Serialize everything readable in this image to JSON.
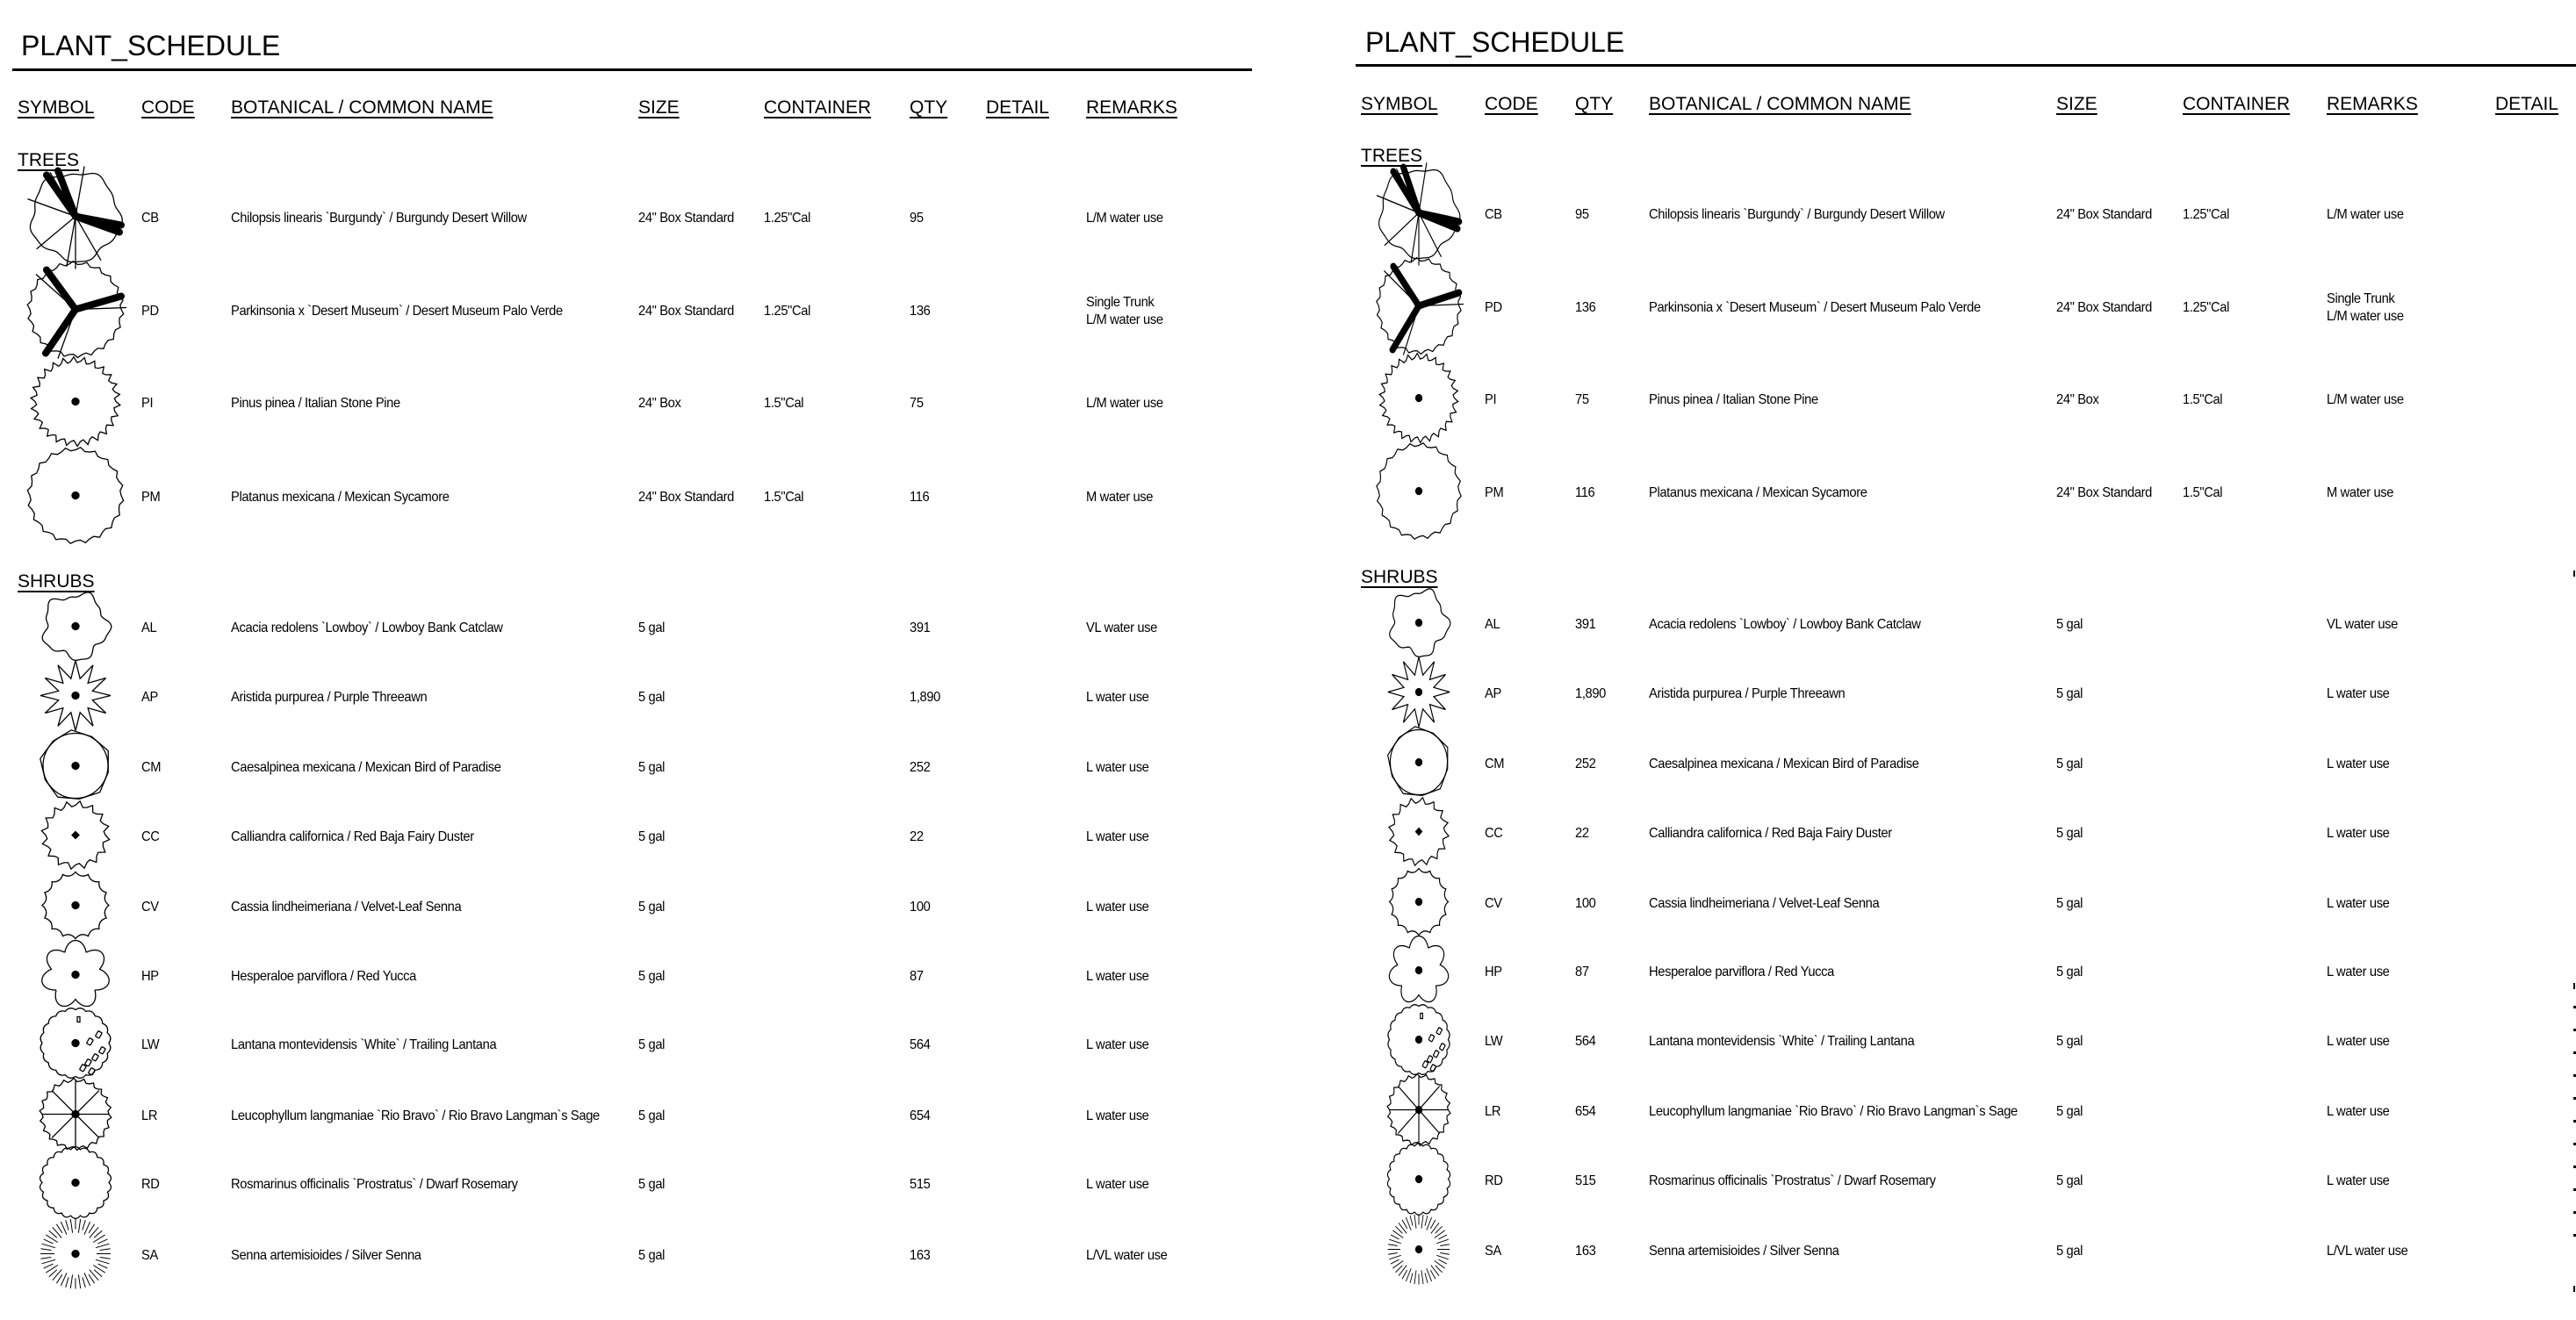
{
  "document": {
    "title": "PLANT_SCHEDULE",
    "sections": {
      "trees": "TREES",
      "shrubs": "SHRUBS"
    }
  },
  "panels": {
    "left": {
      "title": "PLANT_SCHEDULE",
      "headers": {
        "symbol": "SYMBOL",
        "code": "CODE",
        "name": "BOTANICAL / COMMON NAME",
        "size": "SIZE",
        "container": "CONTAINER",
        "qty": "QTY",
        "detail": "DETAIL",
        "remarks": "REMARKS"
      },
      "column_order": [
        "symbol",
        "code",
        "name",
        "size",
        "container",
        "qty",
        "detail",
        "remarks"
      ]
    },
    "right": {
      "title": "PLANT_SCHEDULE",
      "headers": {
        "symbol": "SYMBOL",
        "code": "CODE",
        "qty": "QTY",
        "name": "BOTANICAL / COMMON NAME",
        "size": "SIZE",
        "container": "CONTAINER",
        "remarks": "REMARKS",
        "detail": "DETAIL"
      },
      "column_order": [
        "symbol",
        "code",
        "qty",
        "name",
        "size",
        "container",
        "remarks",
        "detail"
      ]
    }
  },
  "trees": [
    {
      "symbol_icon": "chilopsis-tree-symbol",
      "code": "CB",
      "name": "Chilopsis linearis `Burgundy` / Burgundy Desert Willow",
      "size": "24\" Box Standard",
      "container": "1.25\"Cal",
      "qty": "95",
      "detail": "",
      "remarks": [
        "L/M water use"
      ]
    },
    {
      "symbol_icon": "parkinsonia-tree-symbol",
      "code": "PD",
      "name": "Parkinsonia x `Desert Museum` / Desert Museum Palo Verde",
      "size": "24\" Box Standard",
      "container": "1.25\"Cal",
      "qty": "136",
      "detail": "",
      "remarks": [
        "Single Trunk",
        "L/M water use"
      ]
    },
    {
      "symbol_icon": "pine-tree-symbol",
      "code": "PI",
      "name": "Pinus pinea / Italian Stone Pine",
      "size": "24\" Box",
      "container": "1.5\"Cal",
      "qty": "75",
      "detail": "",
      "remarks": [
        "L/M water use"
      ]
    },
    {
      "symbol_icon": "sycamore-tree-symbol",
      "code": "PM",
      "name": "Platanus mexicana / Mexican Sycamore",
      "size": "24\" Box Standard",
      "container": "1.5\"Cal",
      "qty": "116",
      "detail": "",
      "remarks": [
        "M water use"
      ]
    }
  ],
  "shrubs": [
    {
      "symbol_icon": "catclaw-shrub-symbol",
      "code": "AL",
      "name": "Acacia redolens `Lowboy` / Lowboy Bank Catclaw",
      "size": "5 gal",
      "container": "",
      "qty": "391",
      "detail": "",
      "remarks": [
        "VL water use"
      ]
    },
    {
      "symbol_icon": "threeawn-star-symbol",
      "code": "AP",
      "name": "Aristida purpurea / Purple Threeawn",
      "size": "5 gal",
      "container": "",
      "qty": "1,890",
      "detail": "",
      "remarks": [
        "L water use"
      ]
    },
    {
      "symbol_icon": "bird-of-paradise-shrub-symbol",
      "code": "CM",
      "name": "Caesalpinea mexicana / Mexican Bird of Paradise",
      "size": "5 gal",
      "container": "",
      "qty": "252",
      "detail": "",
      "remarks": [
        "L water use"
      ]
    },
    {
      "symbol_icon": "fairy-duster-shrub-symbol",
      "code": "CC",
      "name": "Calliandra californica / Red Baja Fairy Duster",
      "size": "5 gal",
      "container": "",
      "qty": "22",
      "detail": "",
      "remarks": [
        "L water use"
      ]
    },
    {
      "symbol_icon": "senna-scalloped-shrub-symbol",
      "code": "CV",
      "name": "Cassia lindheimeriana / Velvet-Leaf Senna",
      "size": "5 gal",
      "container": "",
      "qty": "100",
      "detail": "",
      "remarks": [
        "L water use"
      ]
    },
    {
      "symbol_icon": "yucca-flower-symbol",
      "code": "HP",
      "name": "Hesperaloe parviflora / Red Yucca",
      "size": "5 gal",
      "container": "",
      "qty": "87",
      "detail": "",
      "remarks": [
        "L water use"
      ]
    },
    {
      "symbol_icon": "lantana-shrub-symbol",
      "code": "LW",
      "name": "Lantana montevidensis `White` / Trailing Lantana",
      "size": "5 gal",
      "container": "",
      "qty": "564",
      "detail": "",
      "remarks": [
        "L water use"
      ]
    },
    {
      "symbol_icon": "sage-spoked-shrub-symbol",
      "code": "LR",
      "name": "Leucophyllum langmaniae `Rio Bravo` / Rio Bravo Langman`s Sage",
      "size": "5 gal",
      "container": "",
      "qty": "654",
      "detail": "",
      "remarks": [
        "L water use"
      ]
    },
    {
      "symbol_icon": "rosemary-shrub-symbol",
      "code": "RD",
      "name": "Rosmarinus officinalis `Prostratus` / Dwarf Rosemary",
      "size": "5 gal",
      "container": "",
      "qty": "515",
      "detail": "",
      "remarks": [
        "L water use"
      ]
    },
    {
      "symbol_icon": "silver-senna-radial-symbol",
      "code": "SA",
      "name": "Senna artemisioides / Silver Senna",
      "size": "5 gal",
      "container": "",
      "qty": "163",
      "detail": "",
      "remarks": [
        "L/VL water use"
      ]
    }
  ]
}
